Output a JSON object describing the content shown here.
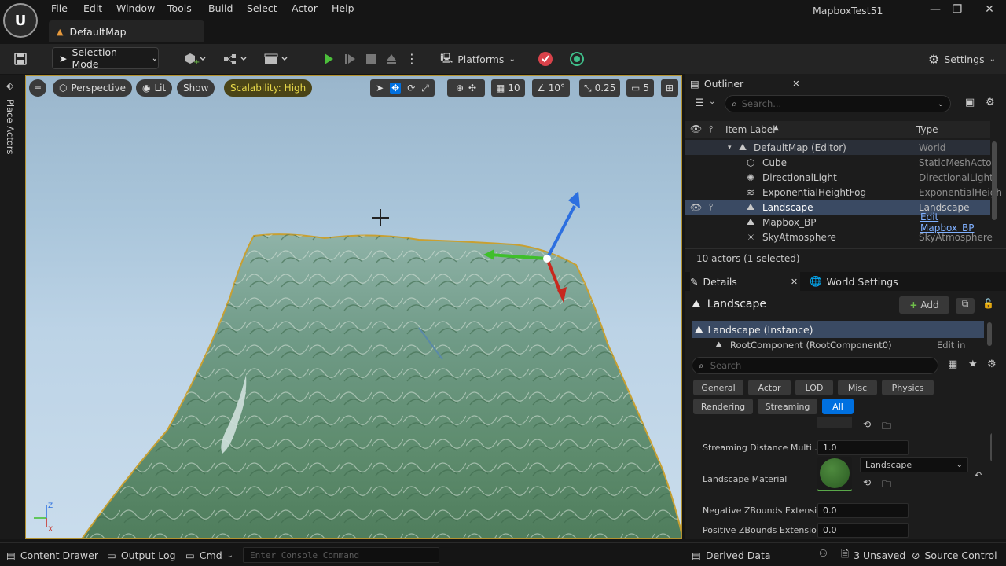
{
  "menu": [
    "File",
    "Edit",
    "Window",
    "Tools",
    "Build",
    "Select",
    "Actor",
    "Help"
  ],
  "document_tab": "DefaultMap",
  "project_name": "MapboxTest51",
  "toolbar": {
    "selection_mode": "Selection Mode",
    "platforms": "Platforms",
    "settings": "Settings"
  },
  "viewport": {
    "left_strip_label": "Place Actors",
    "perspective": "Perspective",
    "lit": "Lit",
    "show": "Show",
    "scalability": "Scalability: High",
    "grid_snap": "10",
    "rotation_snap": "10°",
    "scale_snap": "0.25",
    "camera_speed": "5",
    "axis_z": "Z",
    "axis_x": "X"
  },
  "outliner": {
    "tab": "Outliner",
    "search_placeholder": "Search...",
    "col_label": "Item Label",
    "col_type": "Type",
    "rows": [
      {
        "label": "DefaultMap (Editor)",
        "type": "World"
      },
      {
        "label": "Cube",
        "type": "StaticMeshActor"
      },
      {
        "label": "DirectionalLight",
        "type": "DirectionalLight"
      },
      {
        "label": "ExponentialHeightFog",
        "type": "ExponentialHeigh"
      },
      {
        "label": "Landscape",
        "type": "Landscape"
      },
      {
        "label": "Mapbox_BP",
        "type": "Edit Mapbox_BP"
      },
      {
        "label": "SkyAtmosphere",
        "type": "SkyAtmosphere"
      }
    ],
    "footer": "10 actors (1 selected)"
  },
  "details": {
    "tab": "Details",
    "world_settings_tab": "World Settings",
    "object_name": "Landscape",
    "add_label": "Add",
    "instance_label": "Landscape (Instance)",
    "root_component": "RootComponent (RootComponent0)",
    "edit_in_cpp": "Edit in C++",
    "search_placeholder": "Search",
    "categories": [
      "General",
      "Actor",
      "LOD",
      "Misc",
      "Physics",
      "Rendering",
      "Streaming",
      "All"
    ],
    "properties": {
      "streaming_label": "Streaming Distance Multi...",
      "streaming_value": "1.0",
      "material_label": "Landscape Material",
      "material_value": "Landscape",
      "neg_z_label": "Negative ZBounds Extensi...",
      "neg_z_value": "0.0",
      "pos_z_label": "Positive ZBounds Extension",
      "pos_z_value": "0.0"
    }
  },
  "statusbar": {
    "content_drawer": "Content Drawer",
    "output_log": "Output Log",
    "cmd": "Cmd",
    "console_placeholder": "Enter Console Command",
    "derived_data": "Derived Data",
    "unsaved": "3 Unsaved",
    "source_control": "Source Control"
  },
  "colors": {
    "accent_blue": "#0070e0",
    "selected_row": "#3a4a63",
    "scalability_bg": "#4a4417",
    "landscape_outline": "#c8a032"
  }
}
